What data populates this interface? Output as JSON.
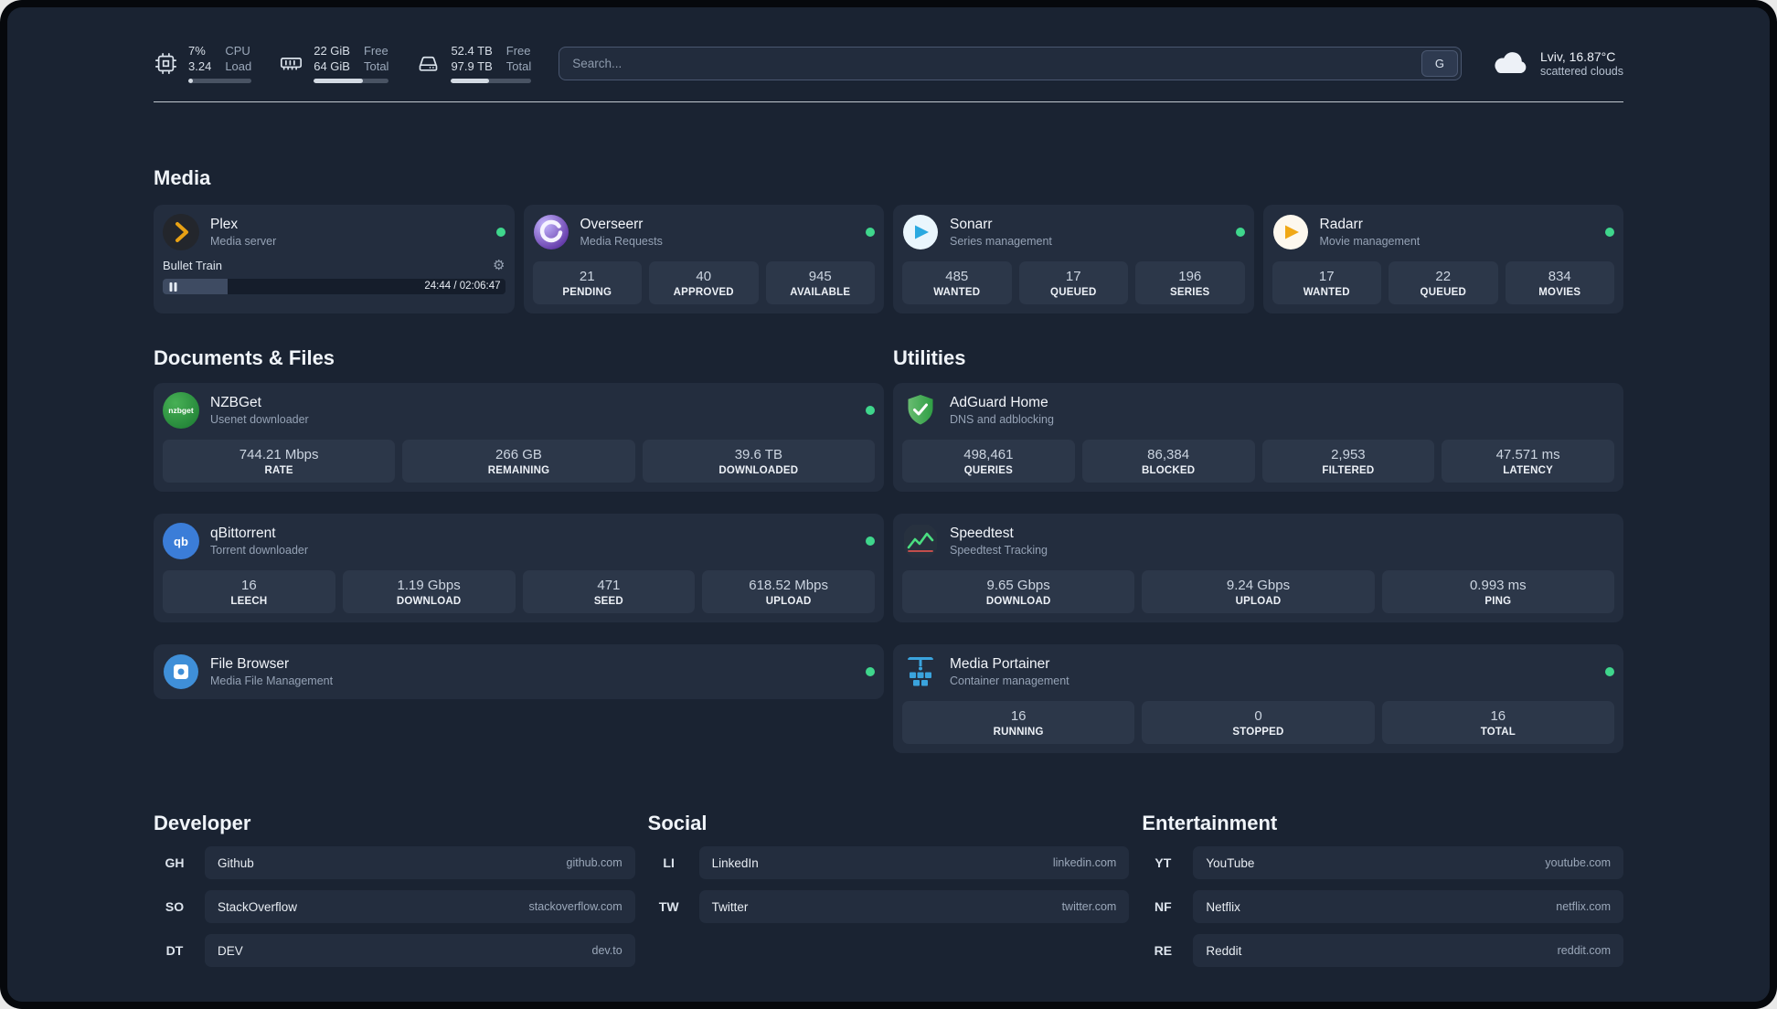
{
  "topbar": {
    "cpu": {
      "value1": "7%",
      "value2": "3.24",
      "label1": "CPU",
      "label2": "Load",
      "bar_percent": 7
    },
    "memory": {
      "value1": "22 GiB",
      "value2": "64 GiB",
      "label1": "Free",
      "label2": "Total",
      "bar_percent": 66
    },
    "disk": {
      "value1": "52.4 TB",
      "value2": "97.9 TB",
      "label1": "Free",
      "label2": "Total",
      "bar_percent": 47
    },
    "search": {
      "placeholder": "Search...",
      "button_label": "G"
    },
    "weather": {
      "location": "Lviv, 16.87°C",
      "condition": "scattered clouds"
    }
  },
  "media": {
    "heading": "Media",
    "plex": {
      "title": "Plex",
      "subtitle": "Media server",
      "now_playing": {
        "title": "Bullet Train",
        "time": "24:44 / 02:06:47",
        "progress_percent": 19
      }
    },
    "overseerr": {
      "title": "Overseerr",
      "subtitle": "Media Requests",
      "stats": [
        {
          "value": "21",
          "label": "PENDING"
        },
        {
          "value": "40",
          "label": "APPROVED"
        },
        {
          "value": "945",
          "label": "AVAILABLE"
        }
      ]
    },
    "sonarr": {
      "title": "Sonarr",
      "subtitle": "Series management",
      "stats": [
        {
          "value": "485",
          "label": "WANTED"
        },
        {
          "value": "17",
          "label": "QUEUED"
        },
        {
          "value": "196",
          "label": "SERIES"
        }
      ]
    },
    "radarr": {
      "title": "Radarr",
      "subtitle": "Movie management",
      "stats": [
        {
          "value": "17",
          "label": "WANTED"
        },
        {
          "value": "22",
          "label": "QUEUED"
        },
        {
          "value": "834",
          "label": "MOVIES"
        }
      ]
    }
  },
  "documents": {
    "heading": "Documents & Files",
    "nzbget": {
      "title": "NZBGet",
      "subtitle": "Usenet downloader",
      "stats": [
        {
          "value": "744.21 Mbps",
          "label": "RATE"
        },
        {
          "value": "266 GB",
          "label": "REMAINING"
        },
        {
          "value": "39.6 TB",
          "label": "DOWNLOADED"
        }
      ]
    },
    "qbittorrent": {
      "title": "qBittorrent",
      "subtitle": "Torrent downloader",
      "stats": [
        {
          "value": "16",
          "label": "LEECH"
        },
        {
          "value": "1.19 Gbps",
          "label": "DOWNLOAD"
        },
        {
          "value": "471",
          "label": "SEED"
        },
        {
          "value": "618.52 Mbps",
          "label": "UPLOAD"
        }
      ]
    },
    "filebrowser": {
      "title": "File Browser",
      "subtitle": "Media File Management"
    }
  },
  "utilities": {
    "heading": "Utilities",
    "adguard": {
      "title": "AdGuard Home",
      "subtitle": "DNS and adblocking",
      "stats": [
        {
          "value": "498,461",
          "label": "QUERIES"
        },
        {
          "value": "86,384",
          "label": "BLOCKED"
        },
        {
          "value": "2,953",
          "label": "FILTERED"
        },
        {
          "value": "47.571 ms",
          "label": "LATENCY"
        }
      ]
    },
    "speedtest": {
      "title": "Speedtest",
      "subtitle": "Speedtest Tracking",
      "stats": [
        {
          "value": "9.65 Gbps",
          "label": "DOWNLOAD"
        },
        {
          "value": "9.24 Gbps",
          "label": "UPLOAD"
        },
        {
          "value": "0.993 ms",
          "label": "PING"
        }
      ]
    },
    "portainer": {
      "title": "Media Portainer",
      "subtitle": "Container management",
      "stats": [
        {
          "value": "16",
          "label": "RUNNING"
        },
        {
          "value": "0",
          "label": "STOPPED"
        },
        {
          "value": "16",
          "label": "TOTAL"
        }
      ]
    }
  },
  "bookmarks": {
    "developer": {
      "heading": "Developer",
      "items": [
        {
          "abbr": "GH",
          "name": "Github",
          "url": "github.com"
        },
        {
          "abbr": "SO",
          "name": "StackOverflow",
          "url": "stackoverflow.com"
        },
        {
          "abbr": "DT",
          "name": "DEV",
          "url": "dev.to"
        }
      ]
    },
    "social": {
      "heading": "Social",
      "items": [
        {
          "abbr": "LI",
          "name": "LinkedIn",
          "url": "linkedin.com"
        },
        {
          "abbr": "TW",
          "name": "Twitter",
          "url": "twitter.com"
        }
      ]
    },
    "entertainment": {
      "heading": "Entertainment",
      "items": [
        {
          "abbr": "YT",
          "name": "YouTube",
          "url": "youtube.com"
        },
        {
          "abbr": "NF",
          "name": "Netflix",
          "url": "netflix.com"
        },
        {
          "abbr": "RE",
          "name": "Reddit",
          "url": "reddit.com"
        }
      ]
    }
  },
  "colors": {
    "accent_green": "#3fd68c",
    "background": "#1a2332",
    "card": "#232d3e"
  },
  "icons": {
    "gear": "⚙",
    "nzbget_text": "nzbget",
    "qb_text": "qb"
  }
}
